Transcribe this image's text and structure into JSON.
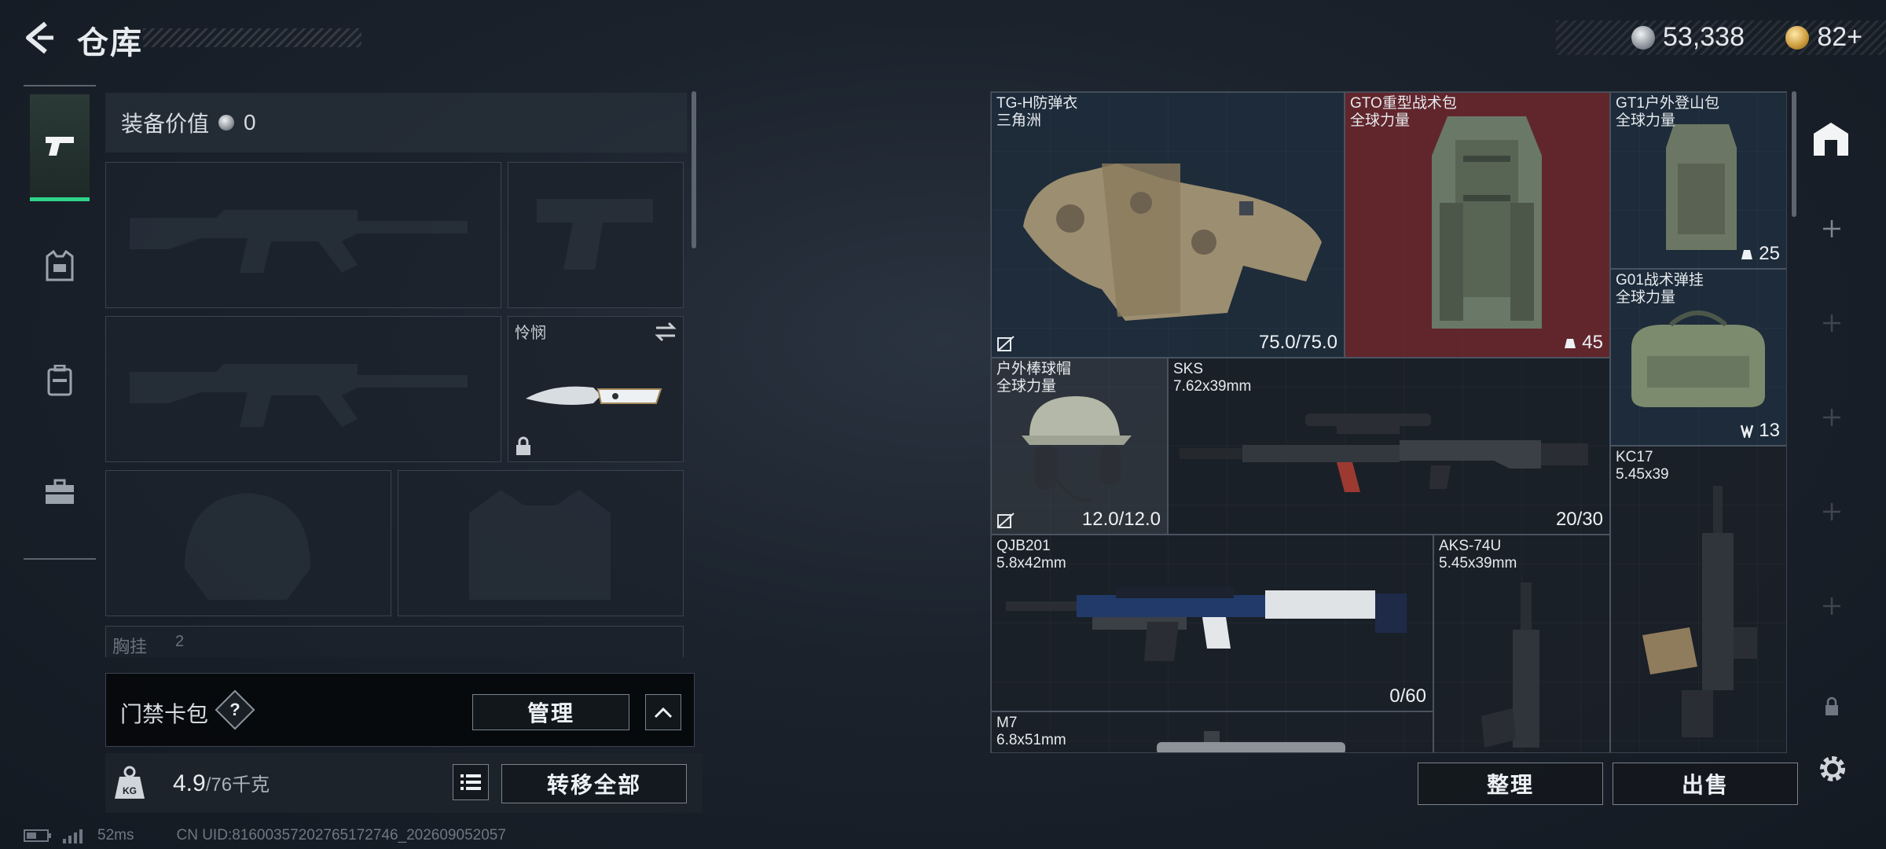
{
  "header": {
    "title": "仓库"
  },
  "currency": {
    "silver": "53,338",
    "gold": "82+"
  },
  "equipment": {
    "value_label": "装备价值",
    "value": "0",
    "melee_label": "怜悯",
    "chest_label": "胸挂",
    "chest_count": "2"
  },
  "keycard": {
    "label": "门禁卡包",
    "help": "?",
    "manage": "管理"
  },
  "weight": {
    "current": "4.9",
    "max": "/76千克",
    "transfer_all": "转移全部"
  },
  "status": {
    "ping": "52ms",
    "uid": "CN UID:8160035720276517274​6_202609052057"
  },
  "stash": {
    "items": [
      {
        "name": "TG-H防弹衣\n三角洲",
        "value": "75.0/75.0"
      },
      {
        "name": "GTO重型战术包\n全球力量",
        "value": "45"
      },
      {
        "name": "GT1户外登山包\n全球力量",
        "value": "25"
      },
      {
        "name": "G01战术弹挂\n全球力量",
        "value": "13"
      },
      {
        "name": "户外棒球帽\n全球力量",
        "value": "12.0/12.0"
      },
      {
        "name": "SKS\n7.62x39mm",
        "value": "20/30"
      },
      {
        "name": "KC17\n5.45x39",
        "value": ""
      },
      {
        "name": "QJB201\n5.8x42mm",
        "value": "0/60"
      },
      {
        "name": "AKS-74U\n5.45x39mm",
        "value": ""
      },
      {
        "name": "M7\n6.8x51mm",
        "value": ""
      }
    ],
    "sort": "整理",
    "sell": "出售"
  },
  "colors": {
    "accent_green": "#2fd48a",
    "rare_red": "#6e282e"
  }
}
